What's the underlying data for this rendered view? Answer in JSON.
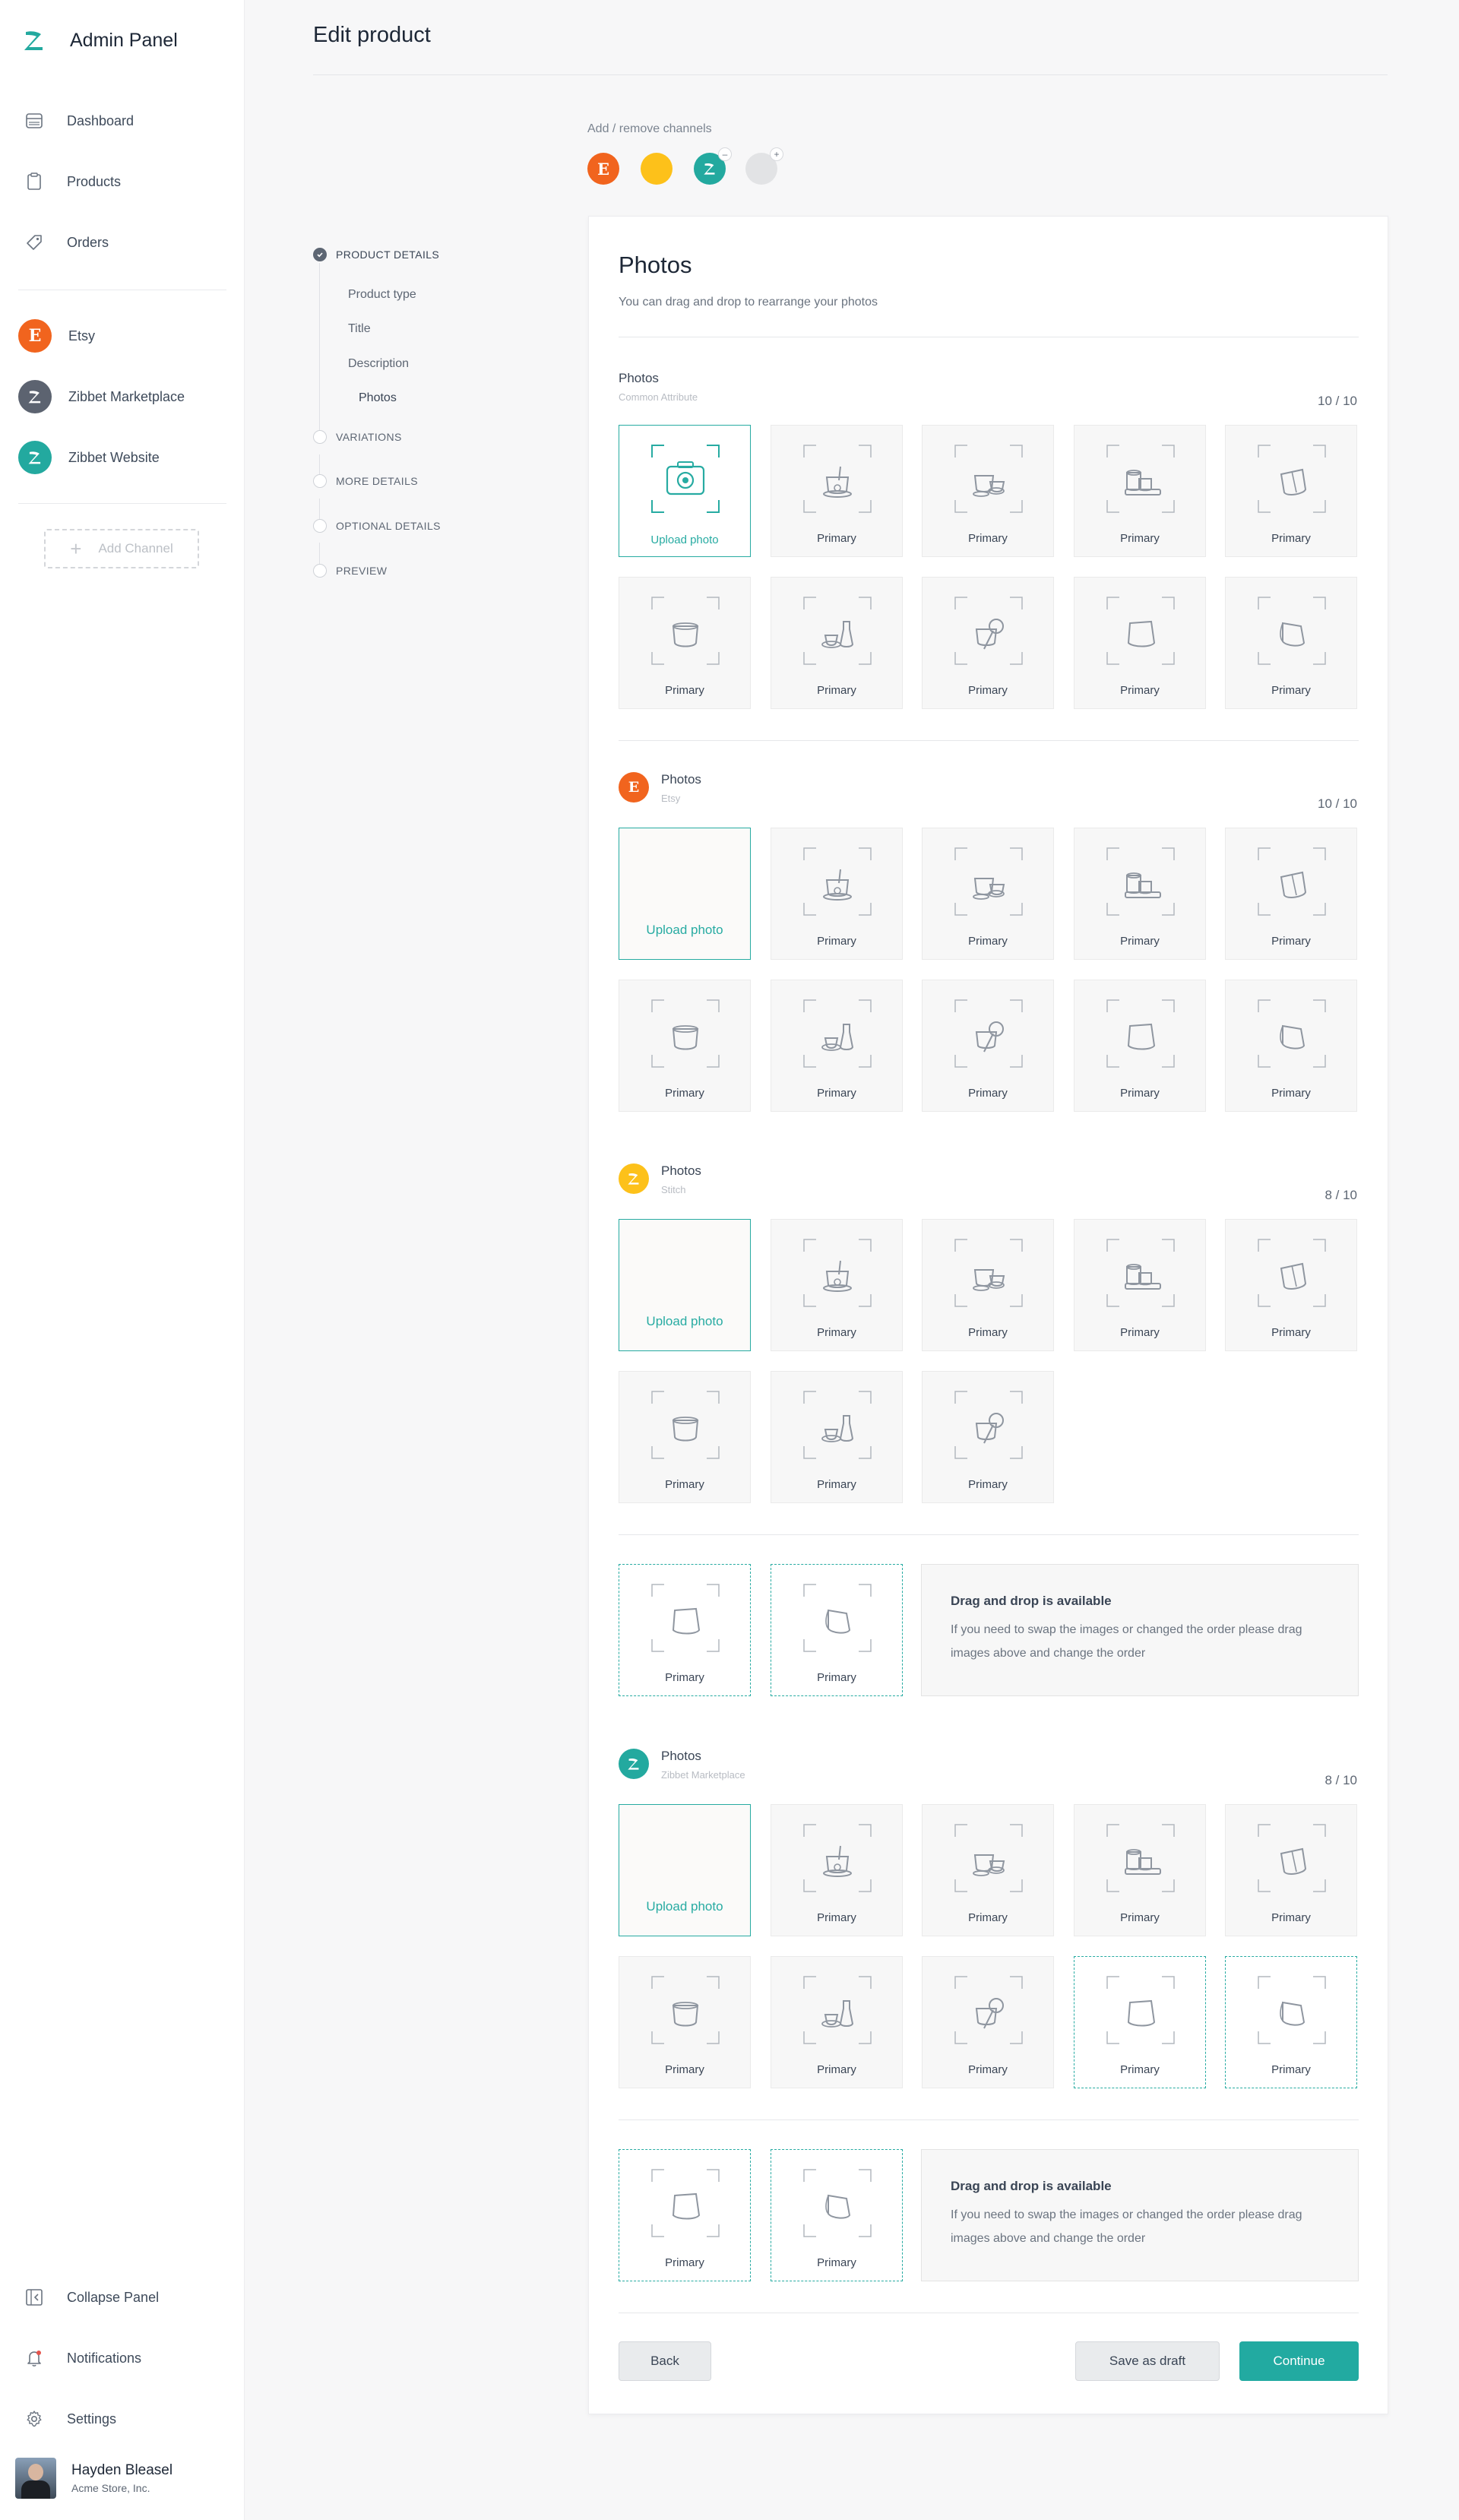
{
  "app": {
    "title": "Admin Panel",
    "page_title": "Edit product"
  },
  "sidebar": {
    "nav": [
      {
        "label": "Dashboard",
        "icon": "dashboard-icon"
      },
      {
        "label": "Products",
        "icon": "clipboard-icon"
      },
      {
        "label": "Orders",
        "icon": "tag-icon"
      }
    ],
    "channels": [
      {
        "label": "Etsy",
        "letter": "E",
        "color": "#f1641e"
      },
      {
        "label": "Zibbet Marketplace",
        "color": "#5c6370"
      },
      {
        "label": "Zibbet Website",
        "color": "#23a99f"
      }
    ],
    "add_channel": "Add Channel",
    "bottom": [
      {
        "label": "Collapse Panel",
        "icon": "collapse-icon"
      },
      {
        "label": "Notifications",
        "icon": "bell-icon"
      },
      {
        "label": "Settings",
        "icon": "gear-icon"
      }
    ],
    "user": {
      "name": "Hayden Bleasel",
      "company": "Acme Store, Inc."
    }
  },
  "channels_bar": {
    "label": "Add / remove channels",
    "items": [
      {
        "name": "etsy",
        "letter": "E",
        "color": "#f1641e"
      },
      {
        "name": "stitch",
        "color": "#fdc11a"
      },
      {
        "name": "zibbet",
        "color": "#23a99f",
        "badge": "–"
      },
      {
        "name": "add",
        "color": "#e2e3e5",
        "badge": "+"
      }
    ]
  },
  "steps": {
    "product_details": "PRODUCT DETAILS",
    "substeps": [
      "Product type",
      "Title",
      "Description",
      "Photos"
    ],
    "variations": "VARIATIONS",
    "more_details": "MORE DETAILS",
    "optional_details": "OPTIONAL DETAILS",
    "preview": "PREVIEW"
  },
  "card": {
    "title": "Photos",
    "subtitle": "You can drag and drop to rearrange your photos",
    "sections": [
      {
        "title": "Photos",
        "subtitle": "Common Attribute",
        "count": "10 / 10",
        "upload_label": "Upload photo"
      },
      {
        "title": "Photos",
        "subtitle": "Etsy",
        "count": "10 / 10",
        "upload_label": "Upload photo"
      },
      {
        "title": "Photos",
        "subtitle": "Stitch",
        "count": "8 / 10",
        "upload_label": "Upload photo"
      },
      {
        "title": "Photos",
        "subtitle": "Zibbet Marketplace",
        "count": "8 / 10",
        "upload_label": "Upload photo"
      }
    ],
    "tile_label": "Primary",
    "dnd_info": {
      "title": "Drag and drop is available",
      "body": "If you need to swap the images or changed the order please drag images above and change the order"
    },
    "buttons": {
      "back": "Back",
      "draft": "Save as draft",
      "continue": "Continue"
    }
  },
  "colors": {
    "accent": "#22aaa1",
    "etsy": "#f1641e",
    "stitch": "#fdc11a",
    "zibbet": "#23a99f"
  }
}
